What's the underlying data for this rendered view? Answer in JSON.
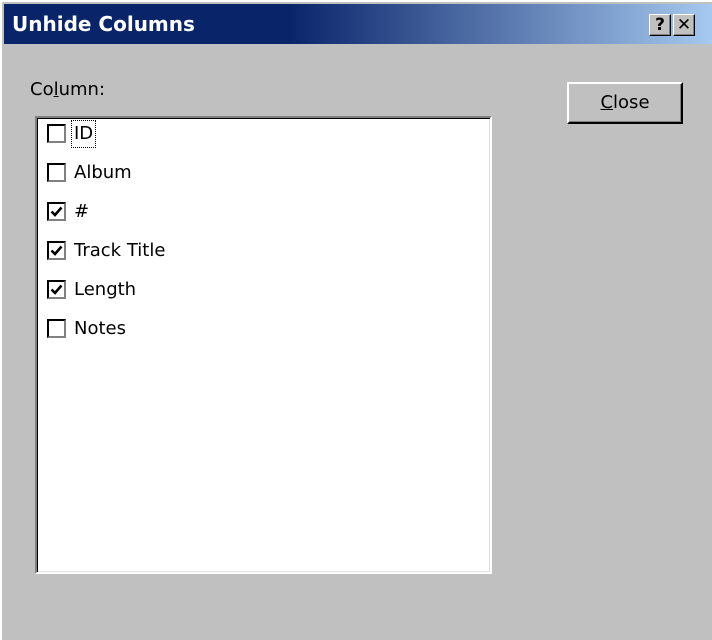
{
  "window": {
    "title": "Unhide Columns",
    "help_label": "?",
    "close_label": "✕"
  },
  "column_label": {
    "pre": "Co",
    "accel": "l",
    "post": "umn:"
  },
  "columns": [
    {
      "label": "ID",
      "checked": false,
      "focused": true
    },
    {
      "label": "Album",
      "checked": false,
      "focused": false
    },
    {
      "label": "#",
      "checked": true,
      "focused": false
    },
    {
      "label": "Track Title",
      "checked": true,
      "focused": false
    },
    {
      "label": "Length",
      "checked": true,
      "focused": false
    },
    {
      "label": "Notes",
      "checked": false,
      "focused": false
    }
  ],
  "close_button": {
    "accel": "C",
    "rest": "lose"
  }
}
